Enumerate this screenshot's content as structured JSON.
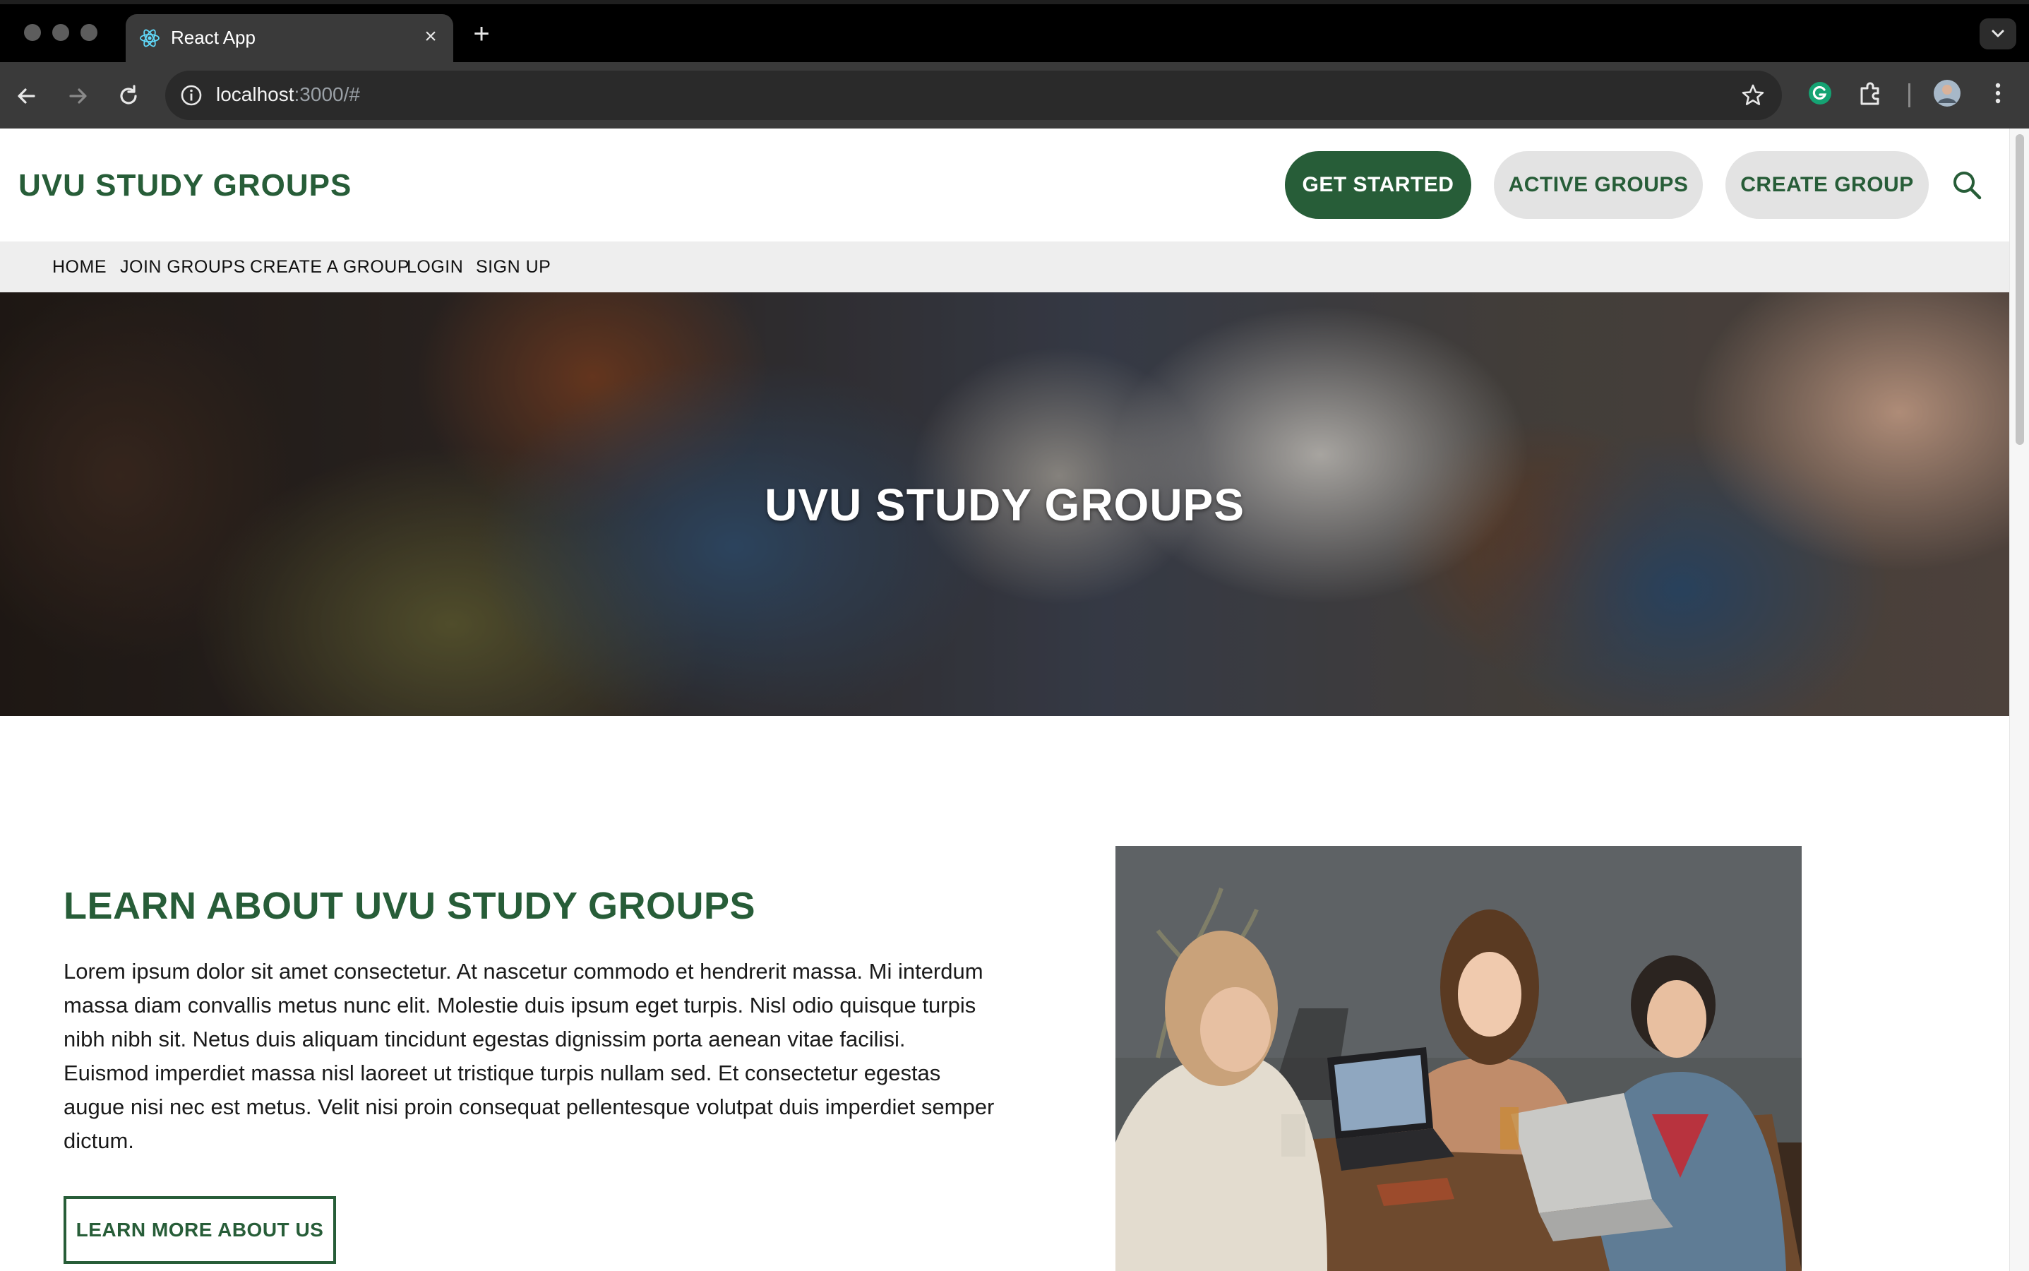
{
  "browser": {
    "tab_title": "React App",
    "url_host": "localhost",
    "url_rest": ":3000/#"
  },
  "header": {
    "brand": "UVU STUDY GROUPS",
    "buttons": {
      "get_started": "GET STARTED",
      "active_groups": "ACTIVE GROUPS",
      "create_group": "CREATE GROUP"
    }
  },
  "subnav": {
    "items": [
      "HOME",
      "JOIN GROUPS",
      "CREATE A GROUP",
      "LOGIN",
      "SIGN UP"
    ]
  },
  "hero": {
    "title": "UVU STUDY GROUPS"
  },
  "about": {
    "heading": "LEARN ABOUT UVU STUDY GROUPS",
    "body": "Lorem ipsum dolor sit amet consectetur. At nascetur commodo et hendrerit massa. Mi interdum massa diam convallis metus nunc elit. Molestie duis ipsum eget turpis. Nisl odio quisque turpis nibh nibh sit. Netus duis aliquam tincidunt egestas dignissim porta aenean vitae facilisi. Euismod imperdiet massa nisl laoreet ut tristique turpis nullam sed. Et consectetur egestas augue nisi nec est metus. Velit nisi proin consequat pellentesque volutpat duis imperdiet semper dictum.",
    "button": "LEARN MORE ABOUT US"
  },
  "theme": {
    "brand_green": "#275d38",
    "pill_gray": "#e3e3e3",
    "subnav_bg": "#eeeeee"
  },
  "icons": [
    "react-logo-icon",
    "close-icon",
    "plus-icon",
    "chevron-down-icon",
    "back-arrow-icon",
    "forward-arrow-icon",
    "reload-icon",
    "info-icon",
    "bookmark-star-icon",
    "grammarly-icon",
    "extensions-puzzle-icon",
    "profile-avatar-icon",
    "more-vertical-icon",
    "search-icon"
  ]
}
